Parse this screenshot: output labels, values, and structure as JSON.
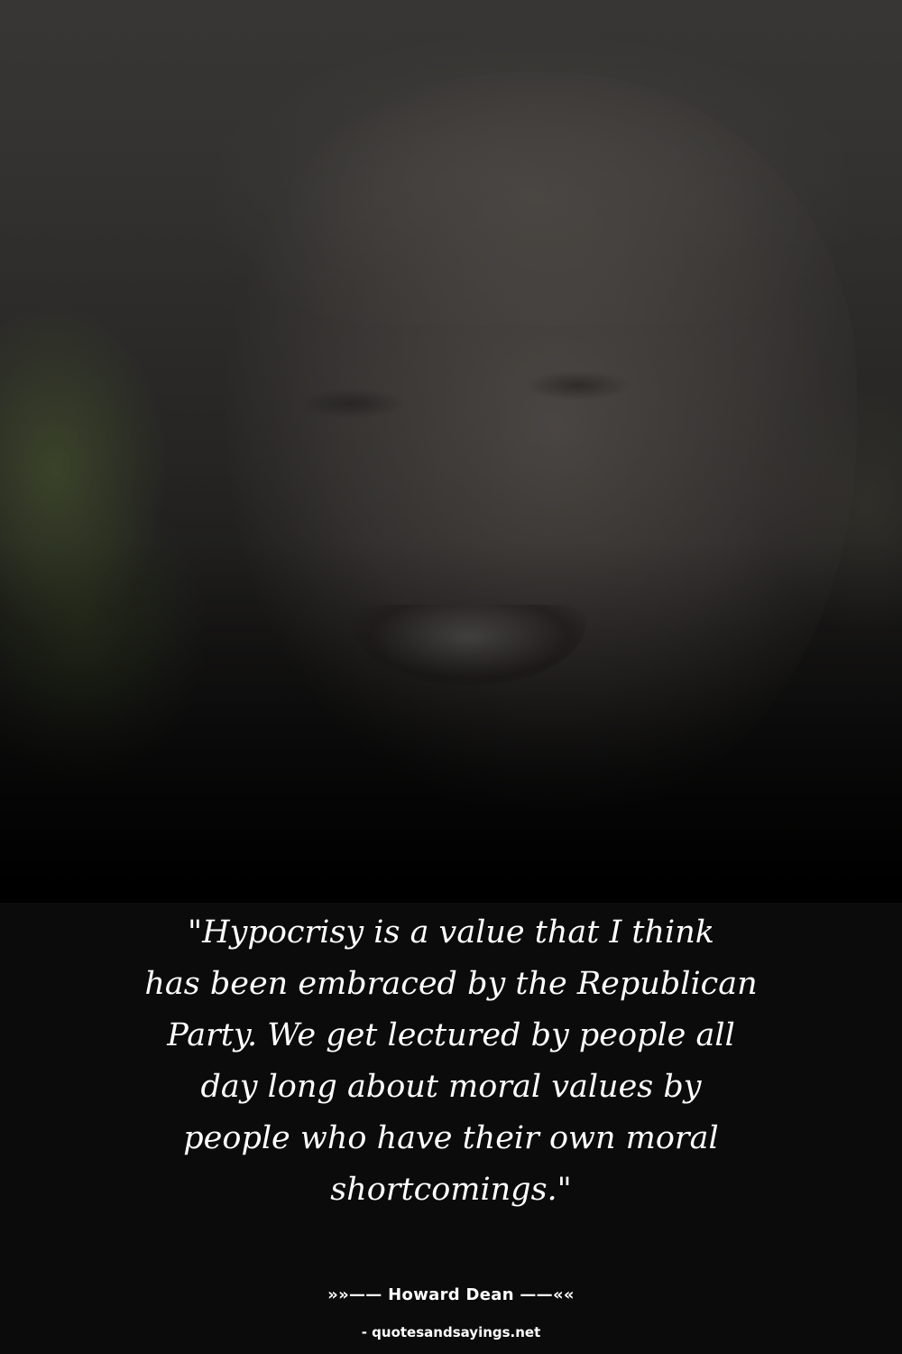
{
  "quote": {
    "text": "\"Hypocrisy is a value that I think\nhas been embraced by the Republican\nParty. We get lectured by people all\nday long about moral values by\npeople who have their own moral\nshortcomings.\""
  },
  "author": {
    "text": "»»—— Howard Dean ——««"
  },
  "source": {
    "text": "- quotesandsayings.net"
  },
  "colors": {
    "background": "#000000",
    "text": "#ffffff"
  }
}
